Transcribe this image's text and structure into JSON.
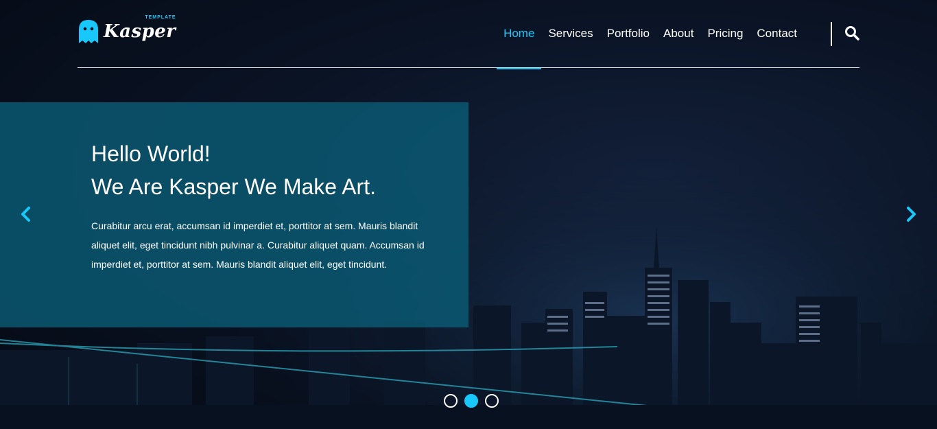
{
  "brand": {
    "name": "Kasper",
    "tag": "TEMPLATE"
  },
  "nav": {
    "items": [
      "Home",
      "Services",
      "Portfolio",
      "About",
      "Pricing",
      "Contact"
    ],
    "active": "Home"
  },
  "hero": {
    "title_line1": "Hello World!",
    "title_line2": "We Are Kasper We Make Art.",
    "text": "Curabitur arcu erat, accumsan id imperdiet et, porttitor at sem. Mauris blandit aliquet elit, eget tincidunt nibh pulvinar a. Curabitur aliquet quam. Accumsan id imperdiet et, porttitor at sem. Mauris blandit aliquet elit, eget tincidunt."
  },
  "slider": {
    "count": 3,
    "active_index": 2
  },
  "colors": {
    "accent": "#19c8fa",
    "panel": "#0a5f78"
  },
  "icons": [
    "ghost-logo-icon",
    "search-icon",
    "chevron-left-icon",
    "chevron-right-icon"
  ]
}
